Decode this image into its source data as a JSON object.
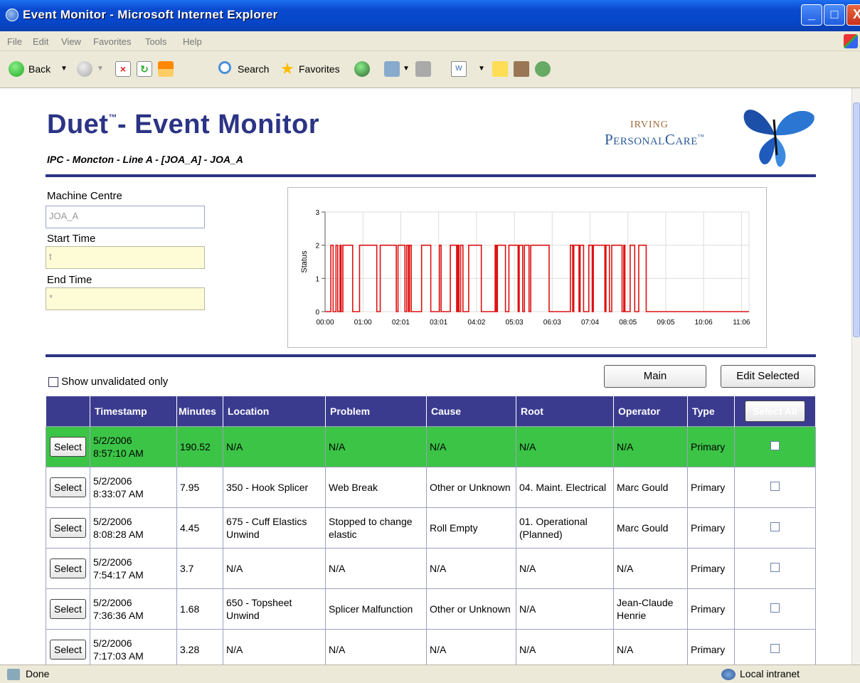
{
  "window": {
    "title": "Event Monitor - Microsoft Internet Explorer",
    "minimize": "_",
    "maximize": "□",
    "close": "X"
  },
  "menu": [
    "File",
    "Edit",
    "View",
    "Favorites",
    "Tools",
    "Help"
  ],
  "toolbar": {
    "back": "Back",
    "search": "Search",
    "favorites": "Favorites"
  },
  "header": {
    "title": "Duet",
    "tm": "™",
    "title_rest": "- Event Monitor",
    "subtitle": "IPC - Moncton - Line A - [JOA_A] - JOA_A",
    "logo_top": "Irving",
    "logo_bottom": "PersonalCare",
    "logo_tm": "™"
  },
  "form": {
    "machine_label": "Machine Centre",
    "machine_value": "JOA_A",
    "start_label": "Start Time",
    "start_value": "t",
    "end_label": "End Time",
    "end_value": "*"
  },
  "chart_data": {
    "type": "line",
    "ylabel": "Status",
    "yticks": [
      "0",
      "1",
      "2",
      "3"
    ],
    "ylim": [
      0,
      3
    ],
    "xticks": [
      "00:00",
      "01:00",
      "02:01",
      "03:01",
      "04:02",
      "05:03",
      "06:03",
      "07:04",
      "08:05",
      "09:05",
      "10:06",
      "11:06"
    ],
    "xlim_minutes": [
      0,
      738
    ],
    "color": "#dd1111",
    "grid": true,
    "series": [
      {
        "points_minutes_status": [
          [
            0,
            0
          ],
          [
            10,
            0
          ],
          [
            10,
            2
          ],
          [
            14,
            2
          ],
          [
            14,
            0
          ],
          [
            19,
            0
          ],
          [
            19,
            2
          ],
          [
            22,
            2
          ],
          [
            22,
            0
          ],
          [
            26,
            0
          ],
          [
            26,
            2
          ],
          [
            28,
            2
          ],
          [
            28,
            0
          ],
          [
            31,
            0
          ],
          [
            31,
            2
          ],
          [
            48,
            2
          ],
          [
            48,
            0
          ],
          [
            60,
            0
          ],
          [
            60,
            2
          ],
          [
            90,
            2
          ],
          [
            90,
            0
          ],
          [
            96,
            0
          ],
          [
            96,
            2
          ],
          [
            124,
            2
          ],
          [
            124,
            0
          ],
          [
            127,
            0
          ],
          [
            127,
            2
          ],
          [
            139,
            2
          ],
          [
            139,
            0
          ],
          [
            142,
            0
          ],
          [
            142,
            2
          ],
          [
            145,
            2
          ],
          [
            145,
            0
          ],
          [
            147,
            0
          ],
          [
            147,
            2
          ],
          [
            150,
            2
          ],
          [
            150,
            0
          ],
          [
            168,
            0
          ],
          [
            168,
            2
          ],
          [
            184,
            2
          ],
          [
            184,
            0
          ],
          [
            199,
            0
          ],
          [
            199,
            2
          ],
          [
            202,
            2
          ],
          [
            202,
            0
          ],
          [
            218,
            0
          ],
          [
            218,
            2
          ],
          [
            229,
            2
          ],
          [
            229,
            0
          ],
          [
            231,
            0
          ],
          [
            231,
            2
          ],
          [
            233,
            2
          ],
          [
            233,
            0
          ],
          [
            236,
            0
          ],
          [
            236,
            2
          ],
          [
            240,
            2
          ],
          [
            240,
            0
          ],
          [
            250,
            0
          ],
          [
            250,
            2
          ],
          [
            249,
            2
          ],
          [
            272,
            2
          ],
          [
            272,
            0
          ],
          [
            296,
            0
          ],
          [
            296,
            2
          ],
          [
            298,
            2
          ],
          [
            298,
            0
          ],
          [
            300,
            0
          ],
          [
            300,
            2
          ],
          [
            314,
            2
          ],
          [
            314,
            0
          ],
          [
            320,
            0
          ],
          [
            320,
            2
          ],
          [
            336,
            2
          ],
          [
            336,
            0
          ],
          [
            338,
            0
          ],
          [
            338,
            2
          ],
          [
            344,
            2
          ],
          [
            344,
            0
          ],
          [
            347,
            0
          ],
          [
            347,
            2
          ],
          [
            355,
            2
          ],
          [
            355,
            0
          ],
          [
            358,
            0
          ],
          [
            358,
            2
          ],
          [
            390,
            2
          ],
          [
            390,
            0
          ],
          [
            427,
            0
          ],
          [
            427,
            2
          ],
          [
            431,
            2
          ],
          [
            431,
            0
          ],
          [
            433,
            0
          ],
          [
            433,
            2
          ],
          [
            442,
            2
          ],
          [
            442,
            0
          ],
          [
            444,
            0
          ],
          [
            444,
            2
          ],
          [
            450,
            2
          ],
          [
            450,
            0
          ],
          [
            459,
            0
          ],
          [
            459,
            2
          ],
          [
            465,
            2
          ],
          [
            465,
            0
          ],
          [
            467,
            0
          ],
          [
            467,
            2
          ],
          [
            487,
            2
          ],
          [
            487,
            0
          ],
          [
            489,
            0
          ],
          [
            489,
            2
          ],
          [
            495,
            2
          ],
          [
            495,
            0
          ],
          [
            499,
            0
          ],
          [
            499,
            2
          ],
          [
            517,
            2
          ],
          [
            517,
            0
          ],
          [
            520,
            0
          ],
          [
            520,
            2
          ],
          [
            522,
            2
          ],
          [
            522,
            0
          ],
          [
            531,
            0
          ],
          [
            531,
            2
          ],
          [
            539,
            2
          ],
          [
            539,
            0
          ],
          [
            546,
            0
          ],
          [
            546,
            2
          ],
          [
            559,
            2
          ],
          [
            559,
            0
          ],
          [
            738,
            0
          ]
        ]
      }
    ]
  },
  "controls": {
    "show_unvalidated": "Show unvalidated only",
    "main": "Main",
    "edit_selected": "Edit Selected",
    "select_all": "Select All"
  },
  "grid": {
    "headers": [
      "Timestamp",
      "Minutes",
      "Location",
      "Problem",
      "Cause",
      "Root",
      "Operator",
      "Type"
    ],
    "select_label": "Select",
    "rows": [
      {
        "date": "5/2/2006",
        "time": "8:57:10 AM",
        "minutes": "190.52",
        "location": "N/A",
        "problem": "N/A",
        "cause": "N/A",
        "root": "N/A",
        "operator": "N/A",
        "type": "Primary"
      },
      {
        "date": "5/2/2006",
        "time": "8:33:07 AM",
        "minutes": "7.95",
        "location": "350 - Hook Splicer",
        "problem": "Web Break",
        "cause": "Other or Unknown",
        "root": "04. Maint. Electrical",
        "operator": "Marc Gould",
        "type": "Primary"
      },
      {
        "date": "5/2/2006",
        "time": "8:08:28 AM",
        "minutes": "4.45",
        "location": "675 - Cuff Elastics Unwind",
        "problem": "Stopped to change elastic",
        "cause": "Roll Empty",
        "root": "01. Operational (Planned)",
        "operator": "Marc Gould",
        "type": "Primary"
      },
      {
        "date": "5/2/2006",
        "time": "7:54:17 AM",
        "minutes": "3.7",
        "location": "N/A",
        "problem": "N/A",
        "cause": "N/A",
        "root": "N/A",
        "operator": "N/A",
        "type": "Primary"
      },
      {
        "date": "5/2/2006",
        "time": "7:36:36 AM",
        "minutes": "1.68",
        "location": "650 - Topsheet Unwind",
        "problem": "Splicer Malfunction",
        "cause": "Other or Unknown",
        "root": "N/A",
        "operator": "Jean-Claude Henrie",
        "type": "Primary"
      },
      {
        "date": "5/2/2006",
        "time": "7:17:03 AM",
        "minutes": "3.28",
        "location": "N/A",
        "problem": "N/A",
        "cause": "N/A",
        "root": "N/A",
        "operator": "N/A",
        "type": "Primary"
      }
    ]
  },
  "status": {
    "done": "Done",
    "zone": "Local intranet"
  }
}
